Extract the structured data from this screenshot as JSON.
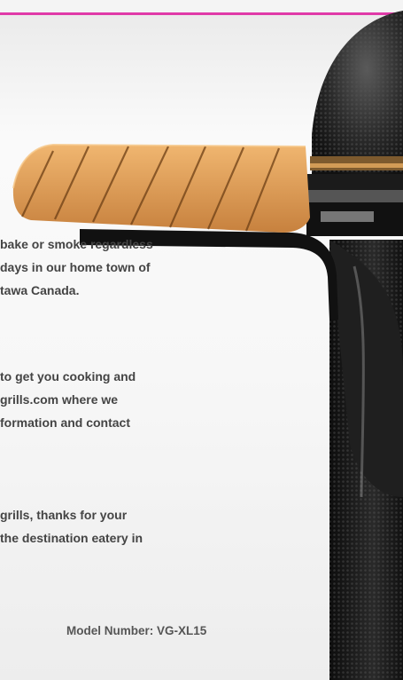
{
  "body": {
    "para1": [
      "bake or smoke regardless",
      "days in our home town of",
      "tawa Canada."
    ],
    "para2": [
      "to get you cooking and",
      "grills.com where we",
      "formation and contact"
    ],
    "para3": [
      "grills, thanks for your",
      "the destination eatery in"
    ]
  },
  "footer": {
    "model_number": "Model Number: VG-XL15"
  },
  "colors": {
    "accent_border": "#e03aa8",
    "slat_wood": "#d99a55",
    "grill_body": "#1a1a1a"
  },
  "icons": {
    "product_image": "kamado-grill-with-wood-side-shelf"
  }
}
